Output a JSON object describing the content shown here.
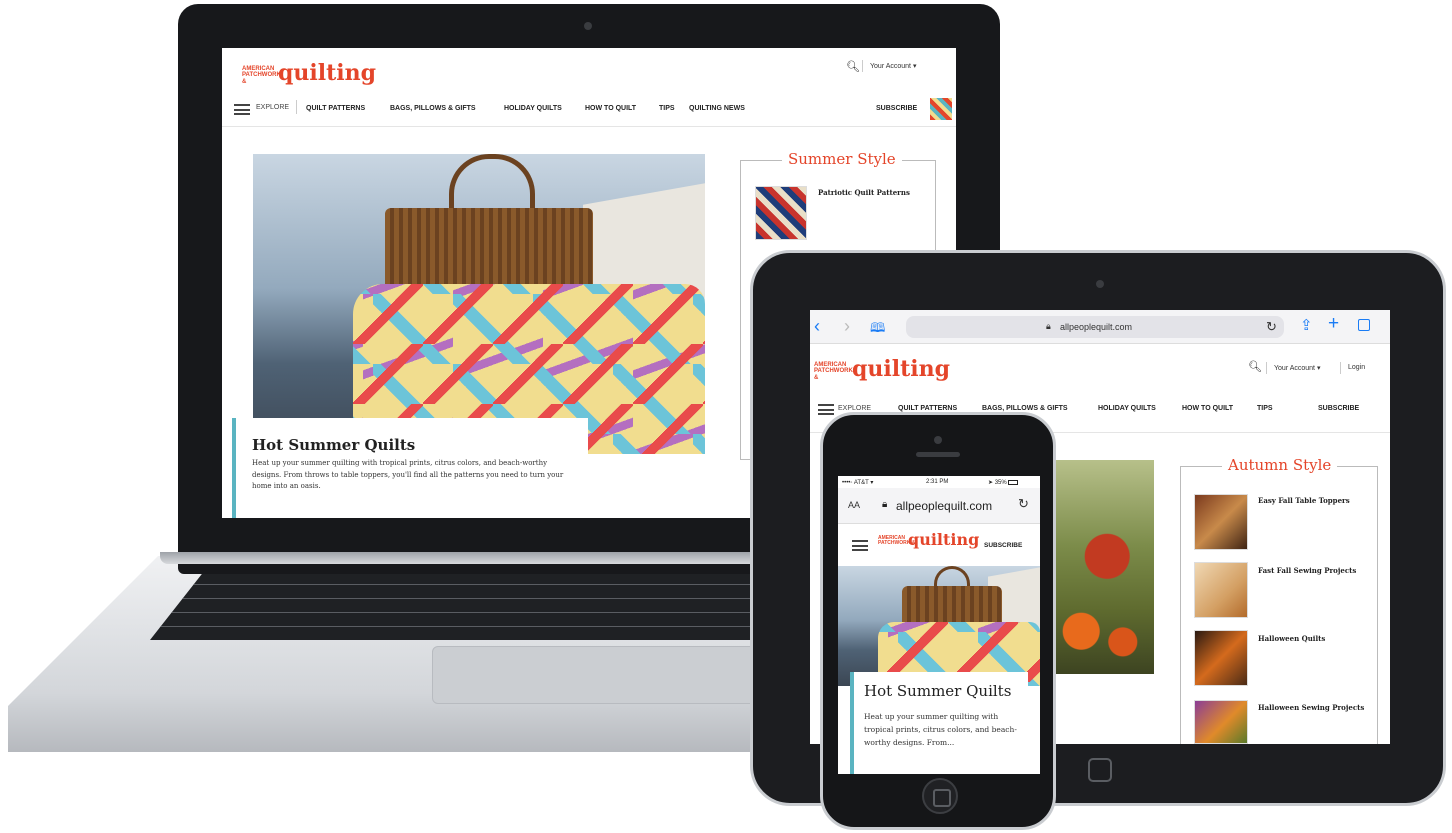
{
  "brand": {
    "logo_top": "AMERICAN",
    "logo_mid": "PATCHWORK &",
    "logo_main": "quilting"
  },
  "laptop": {
    "header": {
      "account_label": "Your Account",
      "explore_label": "EXPLORE",
      "subscribe_label": "SUBSCRIBE"
    },
    "nav": [
      "QUILT PATTERNS",
      "BAGS, PILLOWS & GIFTS",
      "HOLIDAY QUILTS",
      "HOW TO QUILT",
      "TIPS",
      "QUILTING NEWS"
    ],
    "hero": {
      "title": "Hot Summer Quilts",
      "body": "Heat up your summer quilting with tropical prints, citrus colors, and beach-worthy designs. From throws to table toppers, you'll find all the patterns you need to turn your home into an oasis."
    },
    "sidebar": {
      "title": "Summer Style",
      "items": [
        "Patriotic Quilt Patterns"
      ]
    }
  },
  "tablet": {
    "url": "allpeoplequilt.com",
    "header": {
      "account_label": "Your Account",
      "login_label": "Login",
      "explore_label": "EXPLORE",
      "subscribe_label": "SUBSCRIBE"
    },
    "nav": [
      "QUILT PATTERNS",
      "BAGS, PILLOWS & GIFTS",
      "HOLIDAY QUILTS",
      "HOW TO QUILT",
      "TIPS"
    ],
    "sidebar": {
      "title": "Autumn Style",
      "items": [
        "Easy Fall Table Toppers",
        "Fast Fall Sewing Projects",
        "Halloween Quilts",
        "Halloween Sewing Projects"
      ]
    }
  },
  "phone": {
    "status": {
      "carrier": "AT&T",
      "time": "2:31 PM",
      "battery": "35%"
    },
    "url": "allpeoplequilt.com",
    "text_size_label": "AA",
    "subscribe_label": "SUBSCRIBE",
    "hero": {
      "title": "Hot Summer Quilts",
      "body": "Heat up your summer quilting with tropical prints, citrus colors, and beach-worthy designs. From..."
    }
  },
  "colors": {
    "brand_red": "#e4452a",
    "accent_teal": "#5ab4c1",
    "ios_blue": "#1a7cf5"
  }
}
